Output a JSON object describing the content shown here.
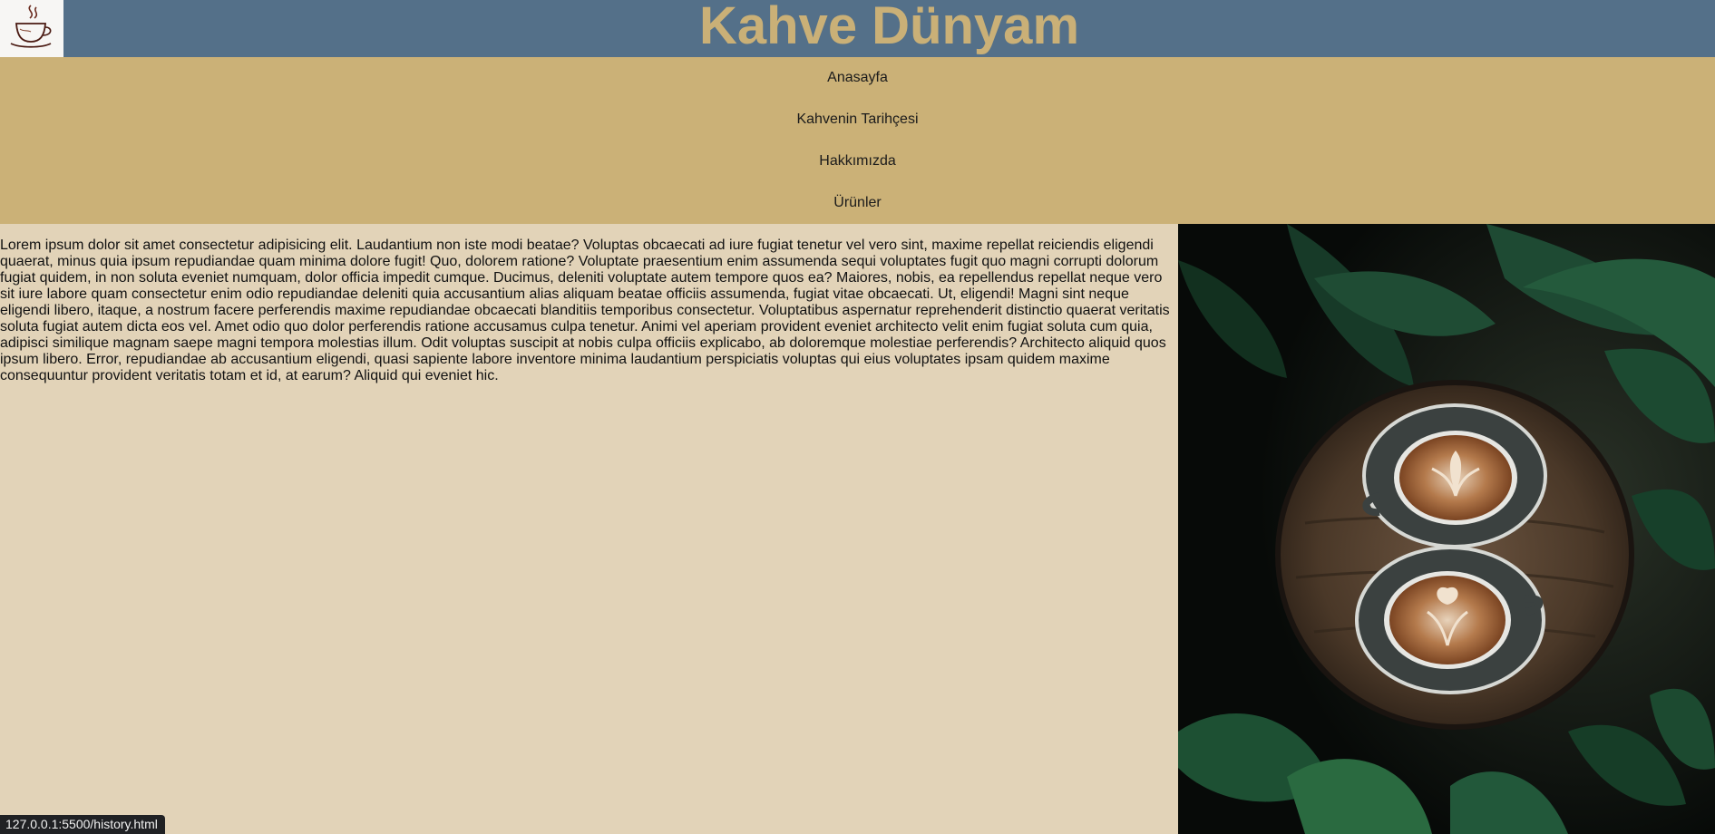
{
  "header": {
    "title": "Kahve Dünyam",
    "logo_icon": "coffee-cup-icon",
    "background_color": "#547089",
    "title_color": "#cab077"
  },
  "nav": {
    "background_color": "#cbb177",
    "items": [
      {
        "label": "Anasayfa"
      },
      {
        "label": "Kahvenin Tarihçesi"
      },
      {
        "label": "Hakkımızda"
      },
      {
        "label": "Ürünler"
      }
    ]
  },
  "main": {
    "background_color": "#e2d3b8",
    "article_text": "Lorem ipsum dolor sit amet consectetur adipisicing elit. Laudantium non iste modi beatae? Voluptas obcaecati ad iure fugiat tenetur vel vero sint, maxime repellat reiciendis eligendi quaerat, minus quia ipsum repudiandae quam minima dolore fugit! Quo, dolorem ratione? Voluptate praesentium enim assumenda sequi voluptates fugit quo magni corrupti dolorum fugiat quidem, in non soluta eveniet numquam, dolor officia impedit cumque. Ducimus, deleniti voluptate autem tempore quos ea? Maiores, nobis, ea repellendus repellat neque vero sit iure labore quam consectetur enim odio repudiandae deleniti quia accusantium alias aliquam beatae officiis assumenda, fugiat vitae obcaecati. Ut, eligendi! Magni sint neque eligendi libero, itaque, a nostrum facere perferendis maxime repudiandae obcaecati blanditiis temporibus consectetur. Voluptatibus aspernatur reprehenderit distinctio quaerat veritatis soluta fugiat autem dicta eos vel. Amet odio quo dolor perferendis ratione accusamus culpa tenetur. Animi vel aperiam provident eveniet architecto velit enim fugiat soluta cum quia, adipisci similique magnam saepe magni tempora molestias illum. Odit voluptas suscipit at nobis culpa officiis explicabo, ab doloremque molestiae perferendis? Architecto aliquid quos ipsum libero. Error, repudiandae ab accusantium eligendi, quasi sapiente labore inventore minima laudantium perspiciatis voluptas qui eius voluptates ipsam quidem maxime consequuntur provident veritatis totam et id, at earum? Aliquid qui eveniet hic.",
    "photo_icon": "coffee-latte-photo"
  },
  "status_bar": {
    "url": "127.0.0.1:5500/history.html"
  }
}
